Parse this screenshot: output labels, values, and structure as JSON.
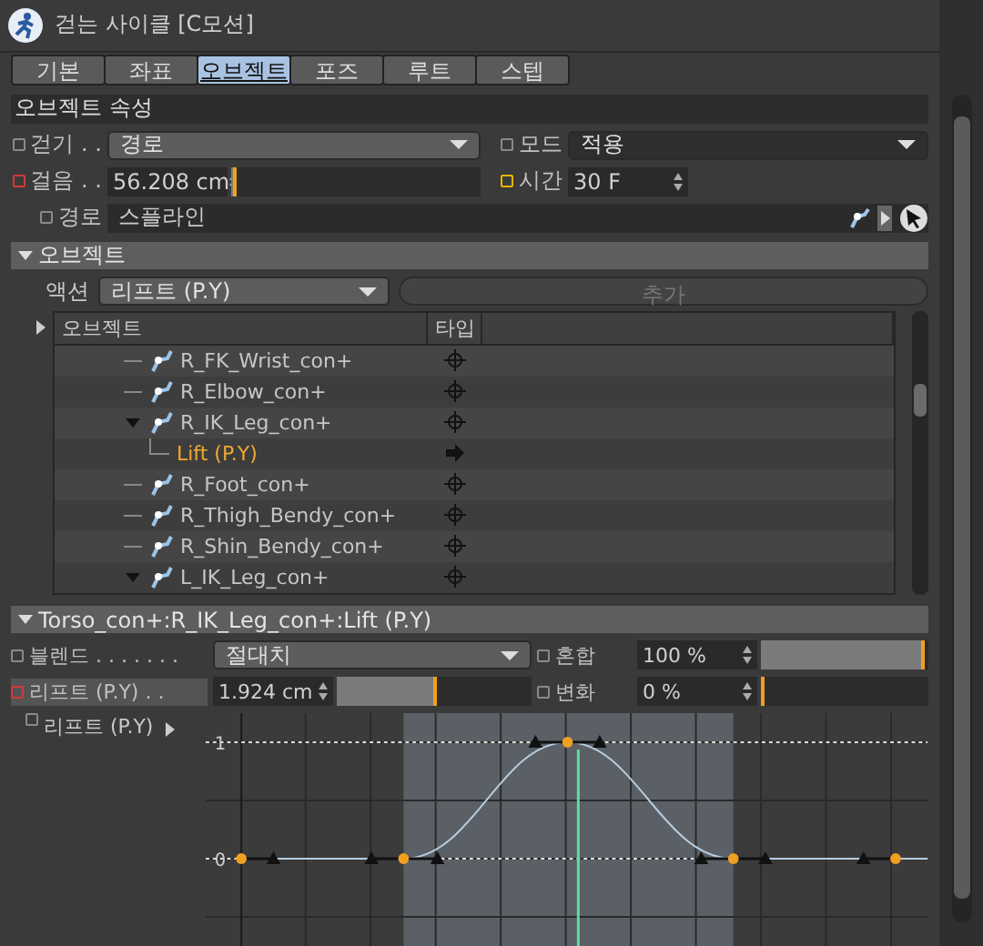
{
  "window": {
    "title": "걷는 사이클 [C모션]"
  },
  "tabs": [
    {
      "label": "기본",
      "selected": false
    },
    {
      "label": "좌표",
      "selected": false
    },
    {
      "label": "오브젝트",
      "selected": true
    },
    {
      "label": "포즈",
      "selected": false
    },
    {
      "label": "루트",
      "selected": false
    },
    {
      "label": "스텝",
      "selected": false
    }
  ],
  "section": {
    "title": "오브젝트 속성"
  },
  "properties": [
    [
      {
        "kind": "dropdown",
        "label": "걷기 . .",
        "color": "#8a8a8a",
        "value": "경로"
      },
      {
        "kind": "dropdown",
        "label": "모드",
        "color": "#8a8a8a",
        "value": "적용"
      }
    ],
    [
      {
        "kind": "slider",
        "label": "걸음 . .",
        "color": "#d23a3a",
        "value": "56.208 cm",
        "level": 0.02
      },
      {
        "kind": "number",
        "label": "시간",
        "color": "#e8b400",
        "value": "30 F"
      }
    ],
    [
      {
        "kind": "link",
        "label": "경로",
        "color": "#8a8a8a",
        "value": "스플라인"
      }
    ]
  ],
  "objects_group": {
    "title": "오브젝트",
    "action_label": "액션",
    "action_value": "리프트 (P.Y)",
    "add_button": "추가",
    "add_disabled": true,
    "columns": [
      "오브젝트",
      "타입"
    ],
    "items": [
      {
        "name": "R_FK_Wrist_con+",
        "kind": "target",
        "expanded": false
      },
      {
        "name": "R_Elbow_con+",
        "kind": "target",
        "expanded": false
      },
      {
        "name": "R_IK_Leg_con+",
        "kind": "target",
        "expanded": true,
        "children": [
          {
            "name": "Lift (P.Y)",
            "kind": "arrow",
            "selected": true
          }
        ]
      },
      {
        "name": "R_Foot_con+",
        "kind": "target",
        "expanded": false
      },
      {
        "name": "R_Thigh_Bendy_con+",
        "kind": "target",
        "expanded": false
      },
      {
        "name": "R_Shin_Bendy_con+",
        "kind": "target",
        "expanded": false
      },
      {
        "name": "L_IK_Leg_con+",
        "kind": "target",
        "expanded": true
      }
    ]
  },
  "blend_group": {
    "title": "Torso_con+:R_IK_Leg_con+:Lift (P.Y)",
    "properties": [
      [
        {
          "kind": "dropdown",
          "label": "블렌드 . . . . . . .",
          "color": "#8a8a8a",
          "value": "절대치"
        },
        {
          "kind": "slider",
          "label": "혼합",
          "color": "#8a8a8a",
          "value": "100 %",
          "level": 1
        }
      ],
      [
        {
          "kind": "slider",
          "label": "리프트 (P.Y) . .",
          "color": "#d23a3a",
          "highlighted": true,
          "value": "1.924 cm",
          "level": 0.52
        },
        {
          "kind": "slider",
          "label": "변화",
          "color": "#8a8a8a",
          "value": "0 %",
          "level": 0
        }
      ]
    ],
    "graph": {
      "label": "리프트 (P.Y)",
      "y_labels": [
        "1",
        "0"
      ]
    }
  }
}
